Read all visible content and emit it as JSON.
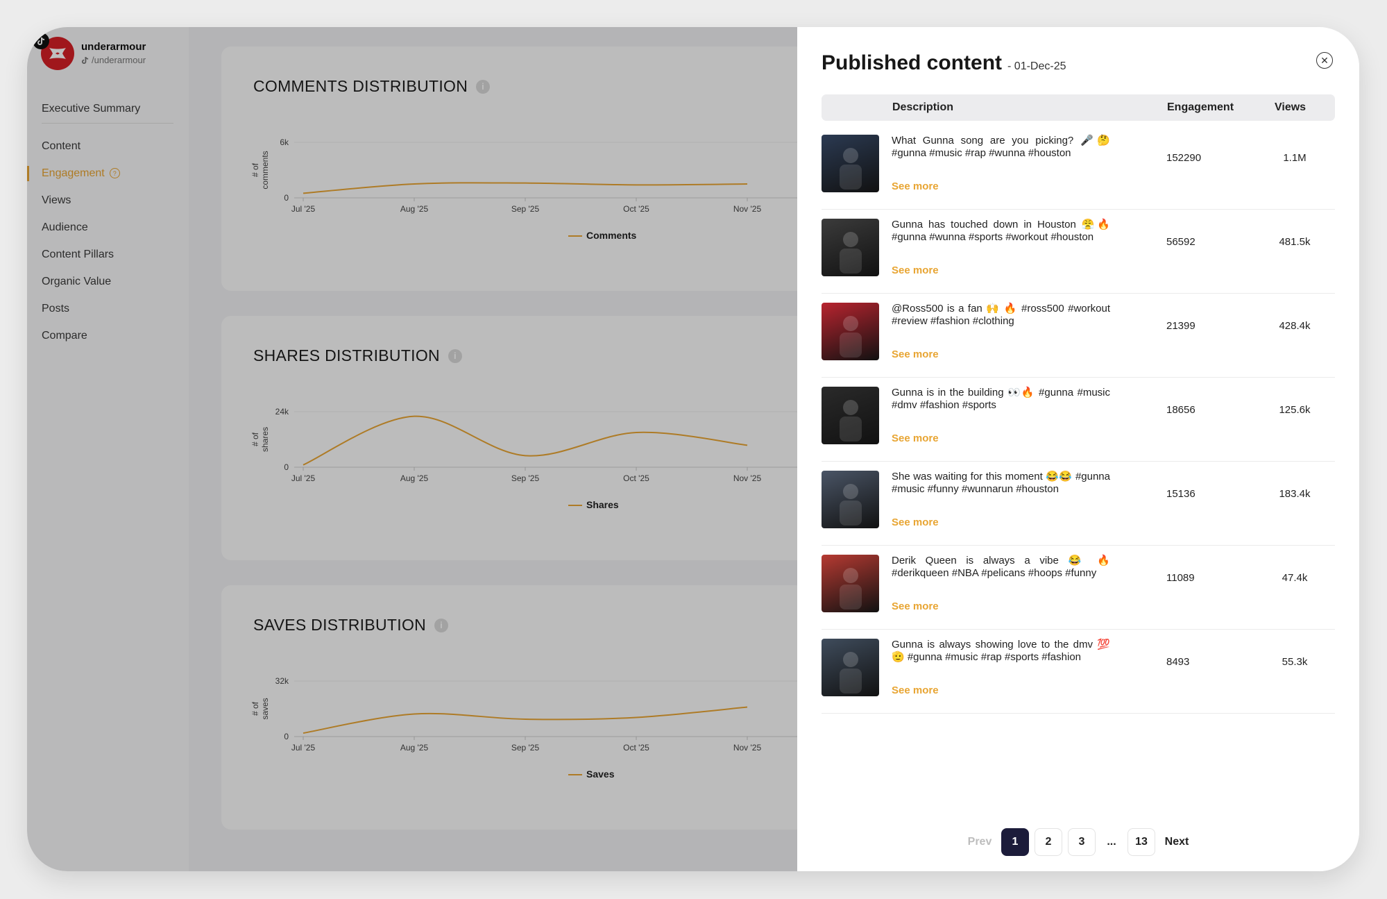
{
  "brand": {
    "name": "underarmour",
    "handle": "/underarmour"
  },
  "nav": [
    {
      "label": "Executive Summary",
      "active": false
    },
    {
      "label": "Content",
      "active": false
    },
    {
      "label": "Engagement",
      "active": true
    },
    {
      "label": "Views",
      "active": false
    },
    {
      "label": "Audience",
      "active": false
    },
    {
      "label": "Content Pillars",
      "active": false
    },
    {
      "label": "Organic Value",
      "active": false
    },
    {
      "label": "Posts",
      "active": false
    },
    {
      "label": "Compare",
      "active": false
    }
  ],
  "accent": "#e8a533",
  "chart_data": [
    {
      "type": "line",
      "title": "COMMENTS DISTRIBUTION",
      "ylabel": "# of comments",
      "ticks": [
        "0",
        "6k"
      ],
      "ylim": [
        0,
        6000
      ],
      "categories": [
        "Jul '25",
        "Aug '25",
        "Sep '25",
        "Oct '25",
        "Nov '25"
      ],
      "series": [
        {
          "name": "Comments",
          "values": [
            500,
            1500,
            1600,
            1400,
            1500
          ]
        }
      ]
    },
    {
      "type": "line",
      "title": "SHARES DISTRIBUTION",
      "ylabel": "# of shares",
      "ticks": [
        "0",
        "24k"
      ],
      "ylim": [
        0,
        24000
      ],
      "categories": [
        "Jul '25",
        "Aug '25",
        "Sep '25",
        "Oct '25",
        "Nov '25"
      ],
      "series": [
        {
          "name": "Shares",
          "values": [
            1000,
            22000,
            5000,
            15000,
            9500
          ]
        }
      ]
    },
    {
      "type": "line",
      "title": "SAVES DISTRIBUTION",
      "ylabel": "# of saves",
      "ticks": [
        "0",
        "32k"
      ],
      "ylim": [
        0,
        32000
      ],
      "categories": [
        "Jul '25",
        "Aug '25",
        "Sep '25",
        "Oct '25",
        "Nov '25"
      ],
      "series": [
        {
          "name": "Saves",
          "values": [
            2000,
            13000,
            10000,
            11000,
            17000
          ]
        }
      ]
    }
  ],
  "panel": {
    "title": "Published content",
    "date": "- 01-Dec-25",
    "columns": {
      "description": "Description",
      "engagement": "Engagement",
      "views": "Views"
    },
    "see_more": "See more",
    "rows": [
      {
        "description": "What Gunna song are you picking? 🎤🤔 #gunna #music #rap #wunna #houston",
        "engagement": "152290",
        "views": "1.1M"
      },
      {
        "description": "Gunna has touched down in Houston 😤🔥 #gunna #wunna #sports #workout #houston",
        "engagement": "56592",
        "views": "481.5k"
      },
      {
        "description": "@Ross500 is a fan 🙌 🔥 #ross500 #workout #review #fashion #clothing",
        "engagement": "21399",
        "views": "428.4k"
      },
      {
        "description": "Gunna is in the building 👀🔥 #gunna #music #dmv #fashion #sports",
        "engagement": "18656",
        "views": "125.6k"
      },
      {
        "description": "She was waiting for this moment 😂😂 #gunna #music #funny #wunnarun #houston",
        "engagement": "15136",
        "views": "183.4k"
      },
      {
        "description": "Derik Queen is always a vibe 😂 🔥 #derikqueen #NBA #pelicans #hoops #funny",
        "engagement": "11089",
        "views": "47.4k"
      },
      {
        "description": "Gunna is always showing love to the dmv 💯🫡 #gunna #music #rap #sports #fashion",
        "engagement": "8493",
        "views": "55.3k"
      }
    ],
    "pagination": {
      "prev": "Prev",
      "pages": [
        "1",
        "2",
        "3",
        "...",
        "13"
      ],
      "current": "1",
      "next": "Next"
    }
  }
}
